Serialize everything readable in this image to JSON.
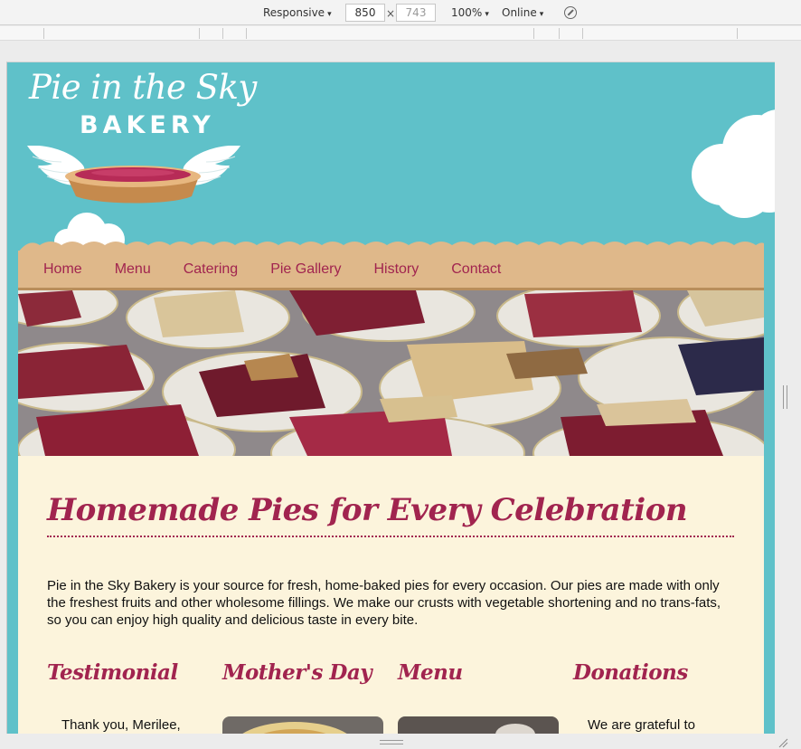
{
  "devtools": {
    "device": "Responsive",
    "width": "850",
    "height_placeholder": "743",
    "times": "×",
    "zoom": "100%",
    "network": "Online",
    "caret": "▾"
  },
  "site": {
    "logo": {
      "script": "Pie in the Sky",
      "bakery": "BAKERY"
    },
    "nav": [
      "Home",
      "Menu",
      "Catering",
      "Pie Gallery",
      "History",
      "Contact"
    ],
    "heading": "Homemade Pies for Every Celebration",
    "intro": "Pie in the Sky Bakery is your source for fresh, home-baked pies for every occasion. Our pies are made with only the freshest fruits and other wholesome fillings. We make our crusts with vegetable shortening and no trans-fats, so you can enjoy high quality and delicious taste in every bite.",
    "columns": {
      "testimonial": {
        "title": "Testimonial",
        "text": "Thank you, Merilee,"
      },
      "mothers_day": {
        "title": "Mother's Day"
      },
      "menu": {
        "title": "Menu"
      },
      "donations": {
        "title": "Donations",
        "text": "We are grateful to"
      }
    }
  },
  "colors": {
    "sky": "#5fc1c9",
    "accent": "#a1244f",
    "nav_bg": "#dfb88a",
    "content_bg": "#fcf4dc"
  }
}
